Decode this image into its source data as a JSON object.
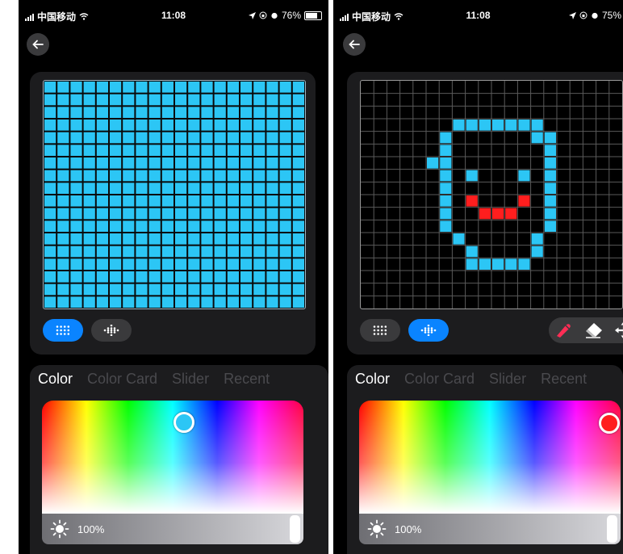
{
  "colors": {
    "cyan": "#2cc6f5",
    "red": "#ff1e1e",
    "accent": "#0a84ff"
  },
  "screens": [
    {
      "status": {
        "carrier": "中国移动",
        "time": "11:08",
        "battery": "76%"
      },
      "mode": "pixel-grid",
      "matrix": {
        "cols": 20,
        "rows": 18,
        "fill": "all-cyan"
      },
      "tabs": [
        "Color",
        "Color Card",
        "Slider",
        "Recent"
      ],
      "active_tab": "Color",
      "brightness": "100%",
      "selected_color": "#2cc6f5"
    },
    {
      "status": {
        "carrier": "中国移动",
        "time": "11:08",
        "battery": "75%"
      },
      "mode": "draw",
      "matrix": {
        "cols": 20,
        "rows": 18,
        "cyan_cells": [
          [
            3,
            7
          ],
          [
            3,
            8
          ],
          [
            3,
            9
          ],
          [
            3,
            10
          ],
          [
            3,
            11
          ],
          [
            3,
            12
          ],
          [
            3,
            13
          ],
          [
            4,
            6
          ],
          [
            4,
            13
          ],
          [
            4,
            14
          ],
          [
            5,
            6
          ],
          [
            5,
            14
          ],
          [
            6,
            5
          ],
          [
            6,
            6
          ],
          [
            6,
            14
          ],
          [
            7,
            6
          ],
          [
            7,
            8
          ],
          [
            7,
            12
          ],
          [
            7,
            14
          ],
          [
            8,
            6
          ],
          [
            8,
            14
          ],
          [
            9,
            6
          ],
          [
            9,
            14
          ],
          [
            10,
            6
          ],
          [
            10,
            14
          ],
          [
            11,
            6
          ],
          [
            11,
            14
          ],
          [
            12,
            7
          ],
          [
            12,
            13
          ],
          [
            13,
            8
          ],
          [
            13,
            13
          ],
          [
            14,
            8
          ],
          [
            14,
            9
          ],
          [
            14,
            10
          ],
          [
            14,
            11
          ],
          [
            14,
            12
          ]
        ],
        "red_cells": [
          [
            9,
            8
          ],
          [
            9,
            12
          ],
          [
            10,
            9
          ],
          [
            10,
            10
          ],
          [
            10,
            11
          ]
        ]
      },
      "tools": [
        "brush-icon",
        "eraser-icon",
        "move-icon"
      ],
      "tabs": [
        "Color",
        "Color Card",
        "Slider",
        "Recent"
      ],
      "active_tab": "Color",
      "brightness": "100%",
      "selected_color": "#ff1e1e"
    }
  ]
}
